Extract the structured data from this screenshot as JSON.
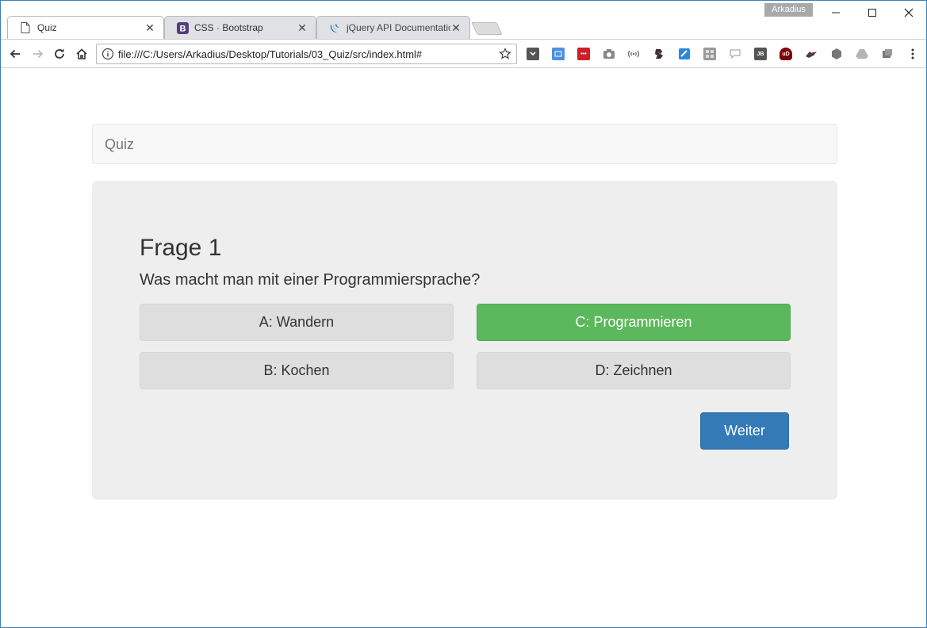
{
  "browser": {
    "tabs": [
      {
        "title": "Quiz",
        "icon": "page-icon",
        "active": true
      },
      {
        "title": "CSS · Bootstrap",
        "icon": "bootstrap-icon",
        "active": false
      },
      {
        "title": "jQuery API Documentatio",
        "icon": "jquery-icon",
        "active": false
      }
    ],
    "profile_name": "Arkadius",
    "address": "file:///C:/Users/Arkadius/Desktop/Tutorials/03_Quiz/src/index.html#",
    "bootstrap_letter": "B",
    "extension_icons": [
      "pocket-icon",
      "screenshot-icon",
      "lastpass-icon",
      "camera-icon",
      "wave-icon",
      "puzzle-icon",
      "dictionary-icon",
      "grid-icon",
      "speech-bubble-icon",
      "jb-icon",
      "ublock-icon",
      "hand-icon",
      "cube-icon",
      "drive-icon",
      "extension-icon"
    ],
    "extension_texts": {
      "lastpass": "•••",
      "jb": "JB",
      "ublock": "uD"
    }
  },
  "navbar": {
    "brand": "Quiz"
  },
  "quiz": {
    "question_title": "Frage 1",
    "question_text": "Was macht man mit einer Programmiersprache?",
    "answers": [
      {
        "label": "A: Wandern",
        "state": "default"
      },
      {
        "label": "B: Kochen",
        "state": "default"
      },
      {
        "label": "C: Programmieren",
        "state": "correct"
      },
      {
        "label": "D: Zeichnen",
        "state": "default"
      }
    ],
    "next_label": "Weiter"
  },
  "colors": {
    "correct": "#5cb85c",
    "primary": "#337ab7",
    "answer_default": "#dedede",
    "jumbotron": "#eeeeee"
  }
}
